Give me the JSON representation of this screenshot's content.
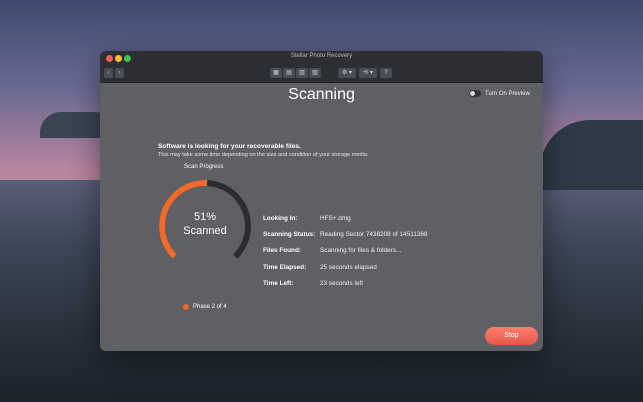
{
  "window": {
    "title": "Stellar Photo Recovery"
  },
  "toolbar": {
    "back_label": "‹",
    "forward_label": "›",
    "view_icons": [
      "▦",
      "▤",
      "▥",
      "▧"
    ],
    "settings_label": "⚙ ▾",
    "history_label": "⟲ ▾",
    "help_label": "?"
  },
  "main": {
    "heading": "Scanning",
    "preview_label": "Turn On Preview",
    "intro_line1": "Software is looking for your recoverable files.",
    "intro_line2": "This may take some time depending on the size and condition of your storage media."
  },
  "progress": {
    "title": "Scan Progress",
    "percent_text": "51%",
    "percent_value": 51,
    "scanned_label": "Scanned",
    "phase_label": "Phase 2 of 4"
  },
  "details": [
    {
      "label": "Looking In:",
      "value": "HFS+.dmg"
    },
    {
      "label": "Scanning Status:",
      "value": "Reading Sector 7438208 of 14511368"
    },
    {
      "label": "Files Found:",
      "value": "Scanning for files & folders..."
    },
    {
      "label": "Time Elapsed:",
      "value": "25 seconds elapsed"
    },
    {
      "label": "Time Left:",
      "value": "23 seconds left"
    }
  ],
  "actions": {
    "stop_label": "Stop"
  },
  "colors": {
    "accent": "#ef6a2b",
    "ring_track": "#2b2d33",
    "stop": "#e9594d"
  }
}
